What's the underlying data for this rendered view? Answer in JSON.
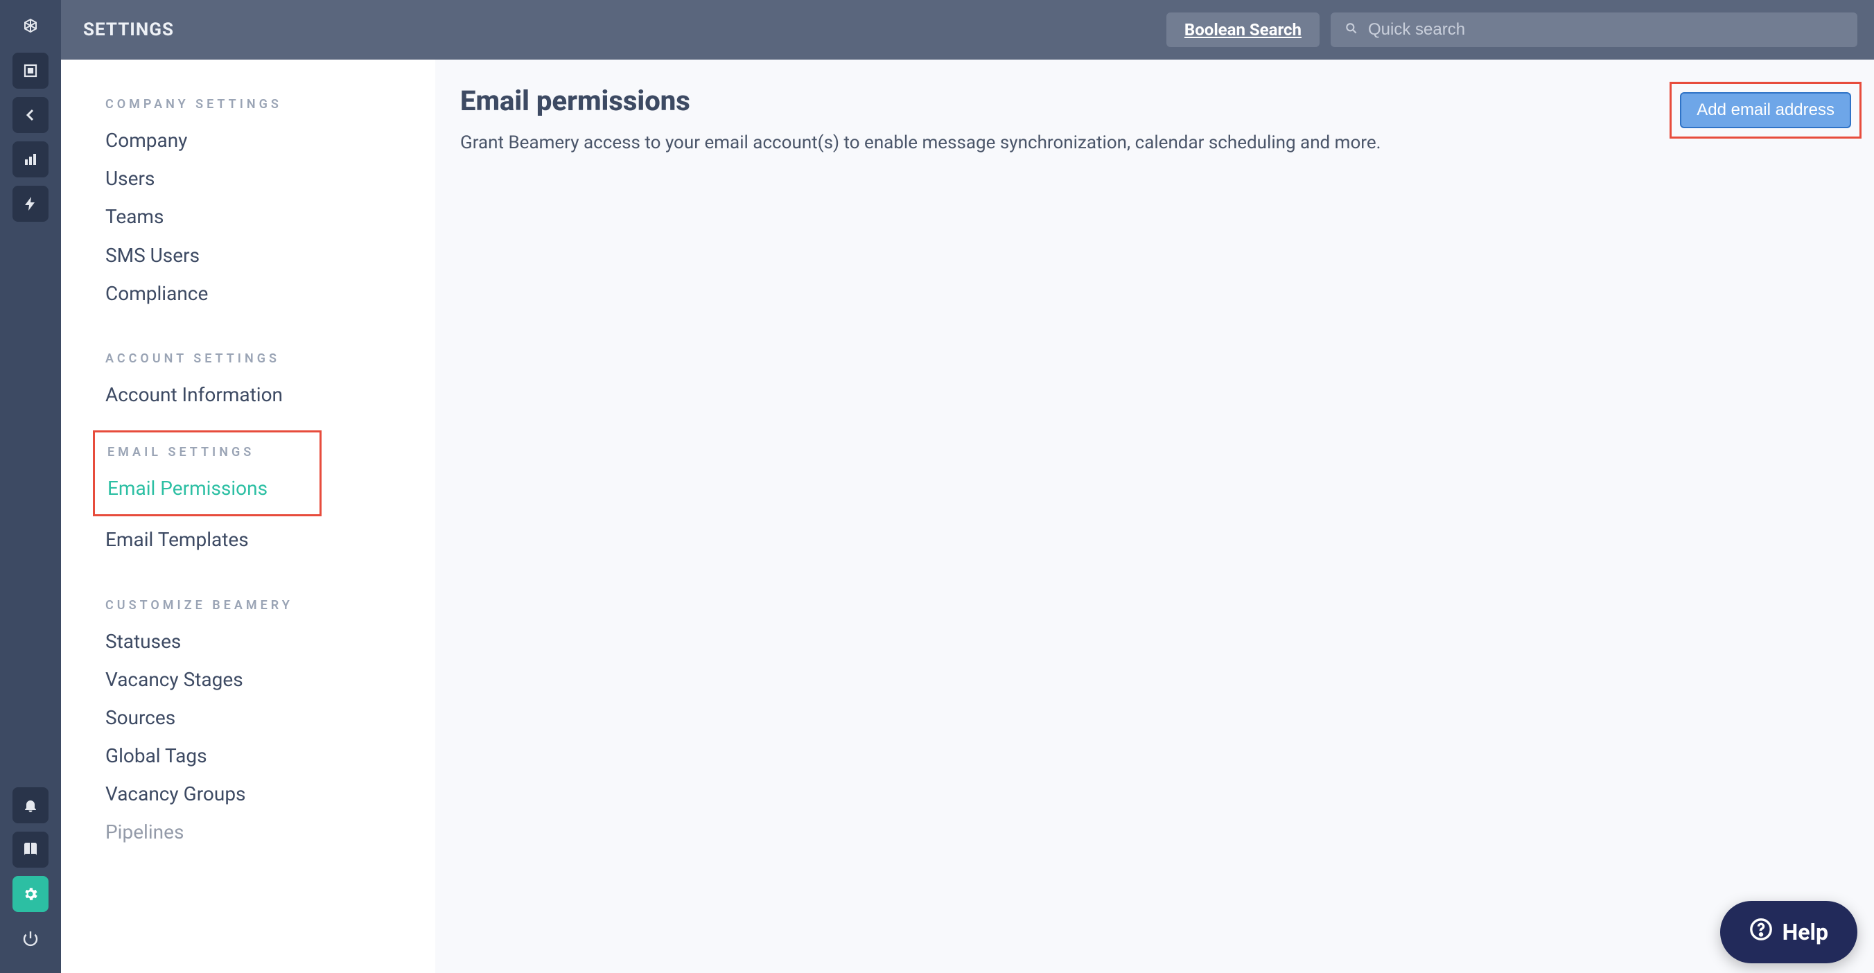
{
  "topbar": {
    "title": "SETTINGS",
    "boolean_search": "Boolean Search",
    "quick_search_placeholder": "Quick search"
  },
  "rail_icons": {
    "logo": "logo-icon",
    "dashboard": "square-icon",
    "back": "chevron-left-icon",
    "reports": "bar-chart-icon",
    "automation": "bolt-icon",
    "notifications": "bell-icon",
    "docs": "book-icon",
    "settings": "gear-icon",
    "power": "power-icon"
  },
  "settings_nav": {
    "sections": [
      {
        "header": "COMPANY SETTINGS",
        "items": [
          "Company",
          "Users",
          "Teams",
          "SMS Users",
          "Compliance"
        ]
      },
      {
        "header": "ACCOUNT SETTINGS",
        "items": [
          "Account Information"
        ]
      },
      {
        "header": "EMAIL SETTINGS",
        "highlighted_header": true,
        "items": [
          "Email Permissions",
          "Email Templates"
        ],
        "active_item": "Email Permissions",
        "highlighted_item": "Email Permissions"
      },
      {
        "header": "CUSTOMIZE BEAMERY",
        "items": [
          "Statuses",
          "Vacancy Stages",
          "Sources",
          "Global Tags",
          "Vacancy Groups",
          "Pipelines"
        ]
      }
    ]
  },
  "page": {
    "title": "Email permissions",
    "description": "Grant Beamery access to your email account(s) to enable message synchronization, calendar scheduling and more.",
    "add_email_label": "Add email address"
  },
  "help": {
    "label": "Help"
  },
  "colors": {
    "rail_bg": "#3d4a63",
    "rail_item_bg": "#29344a",
    "active_teal": "#2cbfa3",
    "topbar_bg": "#5a667d",
    "highlight_red": "#e74c3c",
    "primary_blue": "#6ea6e8",
    "help_bg": "#222a5a"
  }
}
